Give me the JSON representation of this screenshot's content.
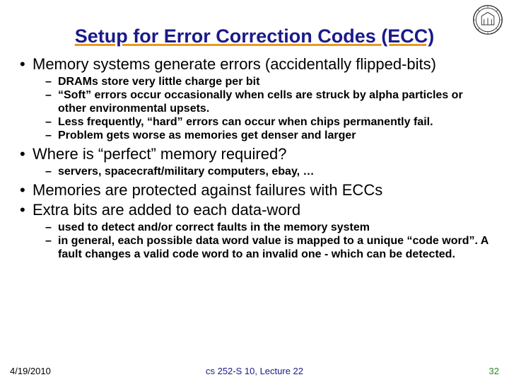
{
  "title": "Setup for Error Correction Codes (ECC)",
  "bullets": [
    {
      "text": "Memory systems generate errors (accidentally flipped-bits)",
      "sub": [
        "DRAMs store very little charge per bit",
        "“Soft” errors occur occasionally when cells are struck by alpha particles or other environmental upsets.",
        "Less frequently, “hard” errors can occur when chips permanently fail.",
        "Problem gets worse as memories get denser and larger"
      ]
    },
    {
      "text": "Where is “perfect” memory required?",
      "sub": [
        "servers, spacecraft/military computers, ebay, …"
      ]
    },
    {
      "text": "Memories are protected against failures with ECCs",
      "sub": []
    },
    {
      "text": "Extra bits are added to each data-word",
      "sub": [
        "used to detect and/or correct faults in the memory system",
        "in general, each possible data word value is mapped to a unique “code word”.  A fault changes a valid code word to an invalid one - which can be detected."
      ]
    }
  ],
  "footer": {
    "date": "4/19/2010",
    "center": "cs 252-S 10, Lecture 22",
    "page": "32"
  }
}
